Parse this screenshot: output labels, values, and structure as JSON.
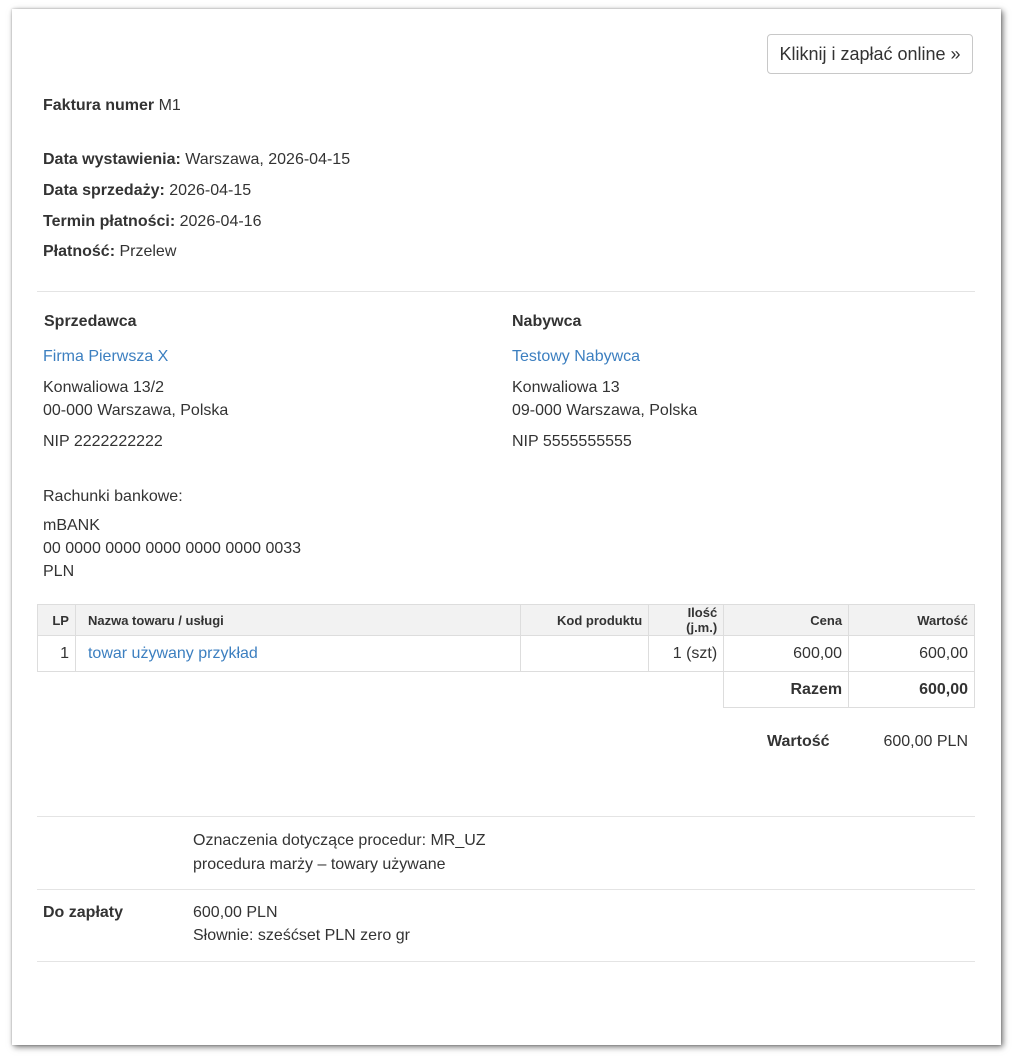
{
  "pay_button": "Kliknij i zapłać online »",
  "invoice": {
    "number_label": "Faktura numer",
    "number": "M1",
    "issue_label": "Data wystawienia:",
    "issue_value": "Warszawa, 2026-04-15",
    "sale_label": "Data sprzedaży:",
    "sale_value": "2026-04-15",
    "due_label": "Termin płatności:",
    "due_value": "2026-04-16",
    "payment_label": "Płatność:",
    "payment_value": "Przelew"
  },
  "seller": {
    "heading": "Sprzedawca",
    "name": "Firma Pierwsza X",
    "street": "Konwaliowa 13/2",
    "city": "00-000 Warszawa, Polska",
    "nip": "NIP 2222222222"
  },
  "buyer": {
    "heading": "Nabywca",
    "name": "Testowy Nabywca",
    "street": "Konwaliowa 13",
    "city": "09-000 Warszawa, Polska",
    "nip": "NIP 5555555555"
  },
  "bank": {
    "label": "Rachunki bankowe:",
    "name": "mBANK",
    "account": "00 0000 0000 0000 0000 0000 0033",
    "currency": "PLN"
  },
  "table": {
    "headers": [
      "LP",
      "Nazwa towaru / usługi",
      "Kod produktu",
      "Ilość (j.m.)",
      "Cena",
      "Wartość"
    ],
    "rows": [
      {
        "lp": "1",
        "name": "towar używany przykład",
        "code": "",
        "qty": "1 (szt)",
        "price": "600,00",
        "value": "600,00"
      }
    ],
    "total_label": "Razem",
    "total_value": "600,00"
  },
  "summary": {
    "value_label": "Wartość",
    "value_amount": "600,00 PLN"
  },
  "notes": {
    "line1": "Oznaczenia dotyczące procedur: MR_UZ",
    "line2": "procedura marży – towary używane"
  },
  "to_pay": {
    "label": "Do zapłaty",
    "amount": "600,00 PLN",
    "words": "Słownie: sześćset PLN zero gr"
  }
}
